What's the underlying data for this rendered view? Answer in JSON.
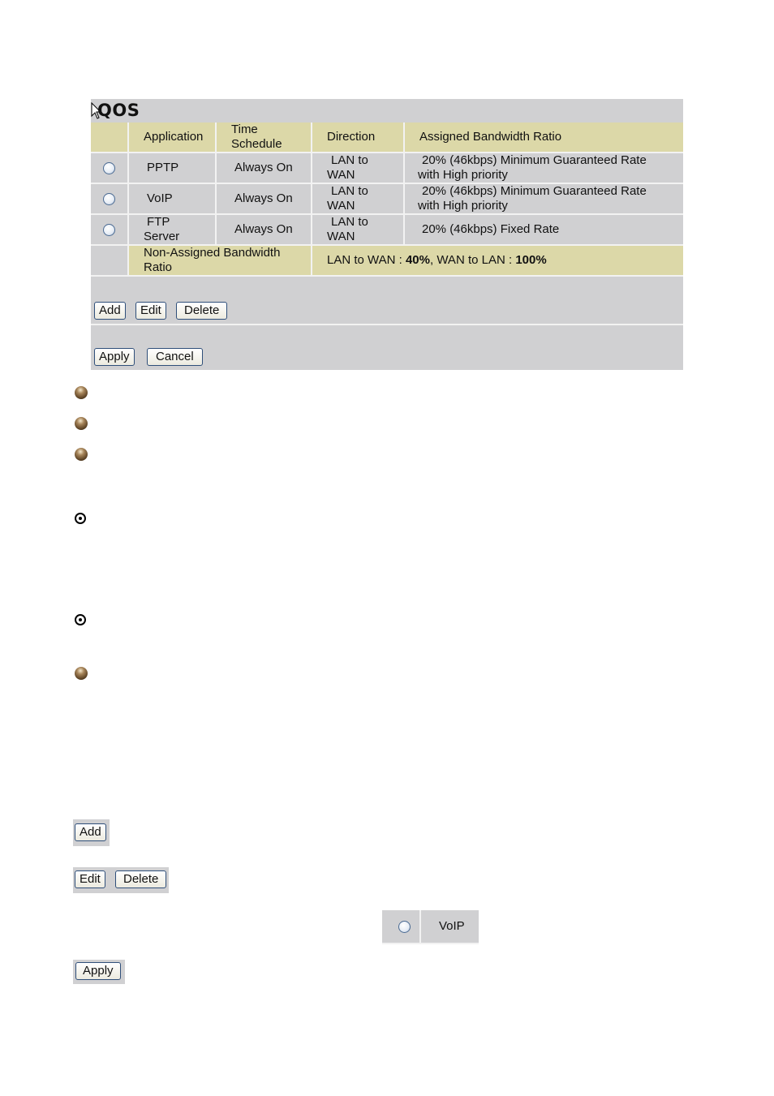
{
  "panel": {
    "title": "QOS",
    "columns": [
      "",
      "Application",
      "Time\nSchedule",
      "Direction",
      "Assigned Bandwidth Ratio"
    ],
    "col_application": "Application",
    "col_time_1": "Time",
    "col_time_2": "Schedule",
    "col_direction": "Direction",
    "col_ratio": "Assigned Bandwidth Ratio",
    "rows": [
      {
        "application": "PPTP",
        "app_line2": "",
        "schedule": "Always On",
        "dir_1": "LAN to",
        "dir_2": "WAN",
        "ratio_1": "20% (46kbps) Minimum Guaranteed Rate",
        "ratio_2": "with High priority",
        "selected": false
      },
      {
        "application": "VoIP",
        "app_line2": "",
        "schedule": "Always On",
        "dir_1": "LAN to",
        "dir_2": "WAN",
        "ratio_1": "20% (46kbps) Minimum Guaranteed Rate",
        "ratio_2": "with High priority",
        "selected": false
      },
      {
        "application": "FTP",
        "app_line2": "Server",
        "schedule": "Always On",
        "dir_1": "LAN to",
        "dir_2": "WAN",
        "ratio_1": "20% (46kbps) Fixed Rate",
        "ratio_2": "",
        "selected": false
      }
    ],
    "non_assigned": {
      "label_1": "Non-Assigned Bandwidth",
      "label_2": "Ratio",
      "lan_to_wan_label": "LAN to WAN : ",
      "lan_to_wan_value": "40%",
      "wan_to_lan_label": ", WAN to LAN : ",
      "wan_to_lan_value": "100%"
    },
    "buttons": {
      "add": "Add",
      "edit": "Edit",
      "delete": "Delete",
      "apply": "Apply",
      "cancel": "Cancel"
    }
  },
  "legend": {
    "add": "Add",
    "edit": "Edit",
    "delete": "Delete",
    "voip_example": "VoIP",
    "apply": "Apply"
  },
  "icons": {
    "bullet": "bronze-ball-bullet-icon",
    "target": "circled-dot-bullet-icon",
    "cursor": "mouse-pointer-icon"
  },
  "colors": {
    "panel_bg": "#d0d0d2",
    "header_bg": "#dcd8a8",
    "divider": "#f2f2f2",
    "button_border": "#2f4f7a"
  }
}
